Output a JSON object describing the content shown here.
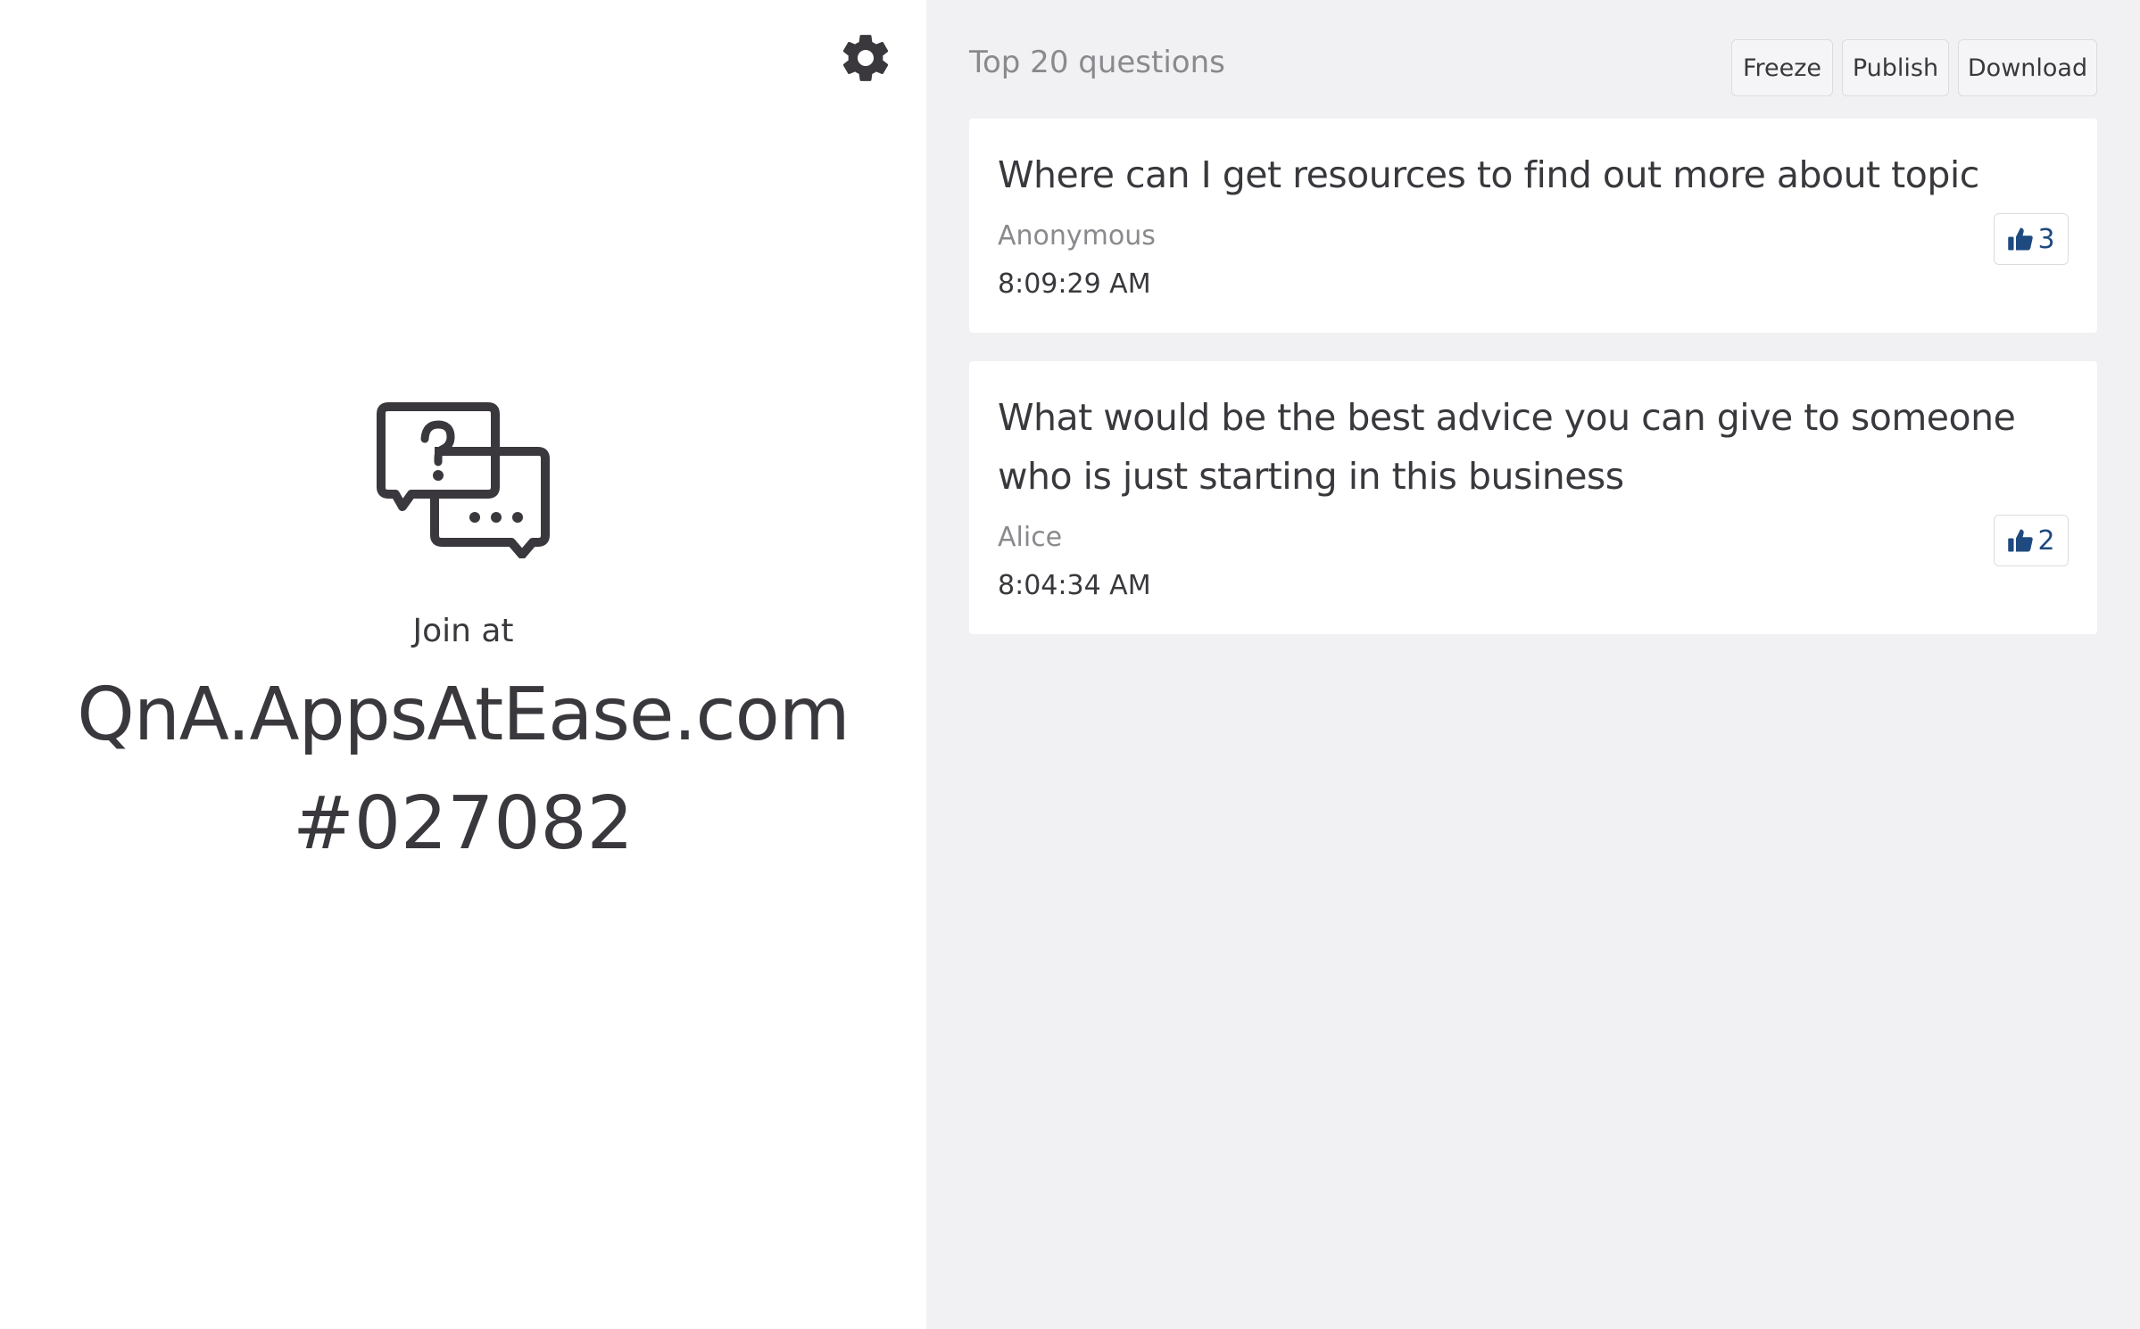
{
  "left_panel": {
    "join_label": "Join at",
    "join_url": "QnA.AppsAtEase.com",
    "event_code": "#027082"
  },
  "right_panel": {
    "title": "Top 20 questions",
    "toolbar": {
      "freeze_label": "Freeze",
      "publish_label": "Publish",
      "download_label": "Download"
    },
    "questions": [
      {
        "text": "Where can I get resources to find out more about topic",
        "author": "Anonymous",
        "time": "8:09:29 AM",
        "votes": "3"
      },
      {
        "text": "What would be the best advice you can give to someone who is just starting in this business",
        "author": "Alice",
        "time": "8:04:34 AM",
        "votes": "2"
      }
    ]
  },
  "icons": {
    "settings": "gear-icon",
    "logo": "chat-question-icon",
    "vote": "thumbs-up-icon"
  },
  "colors": {
    "text": "#3a383d",
    "muted": "#8a898d",
    "panel_bg": "#f1f1f3",
    "vote_accent": "#1e4a80"
  }
}
